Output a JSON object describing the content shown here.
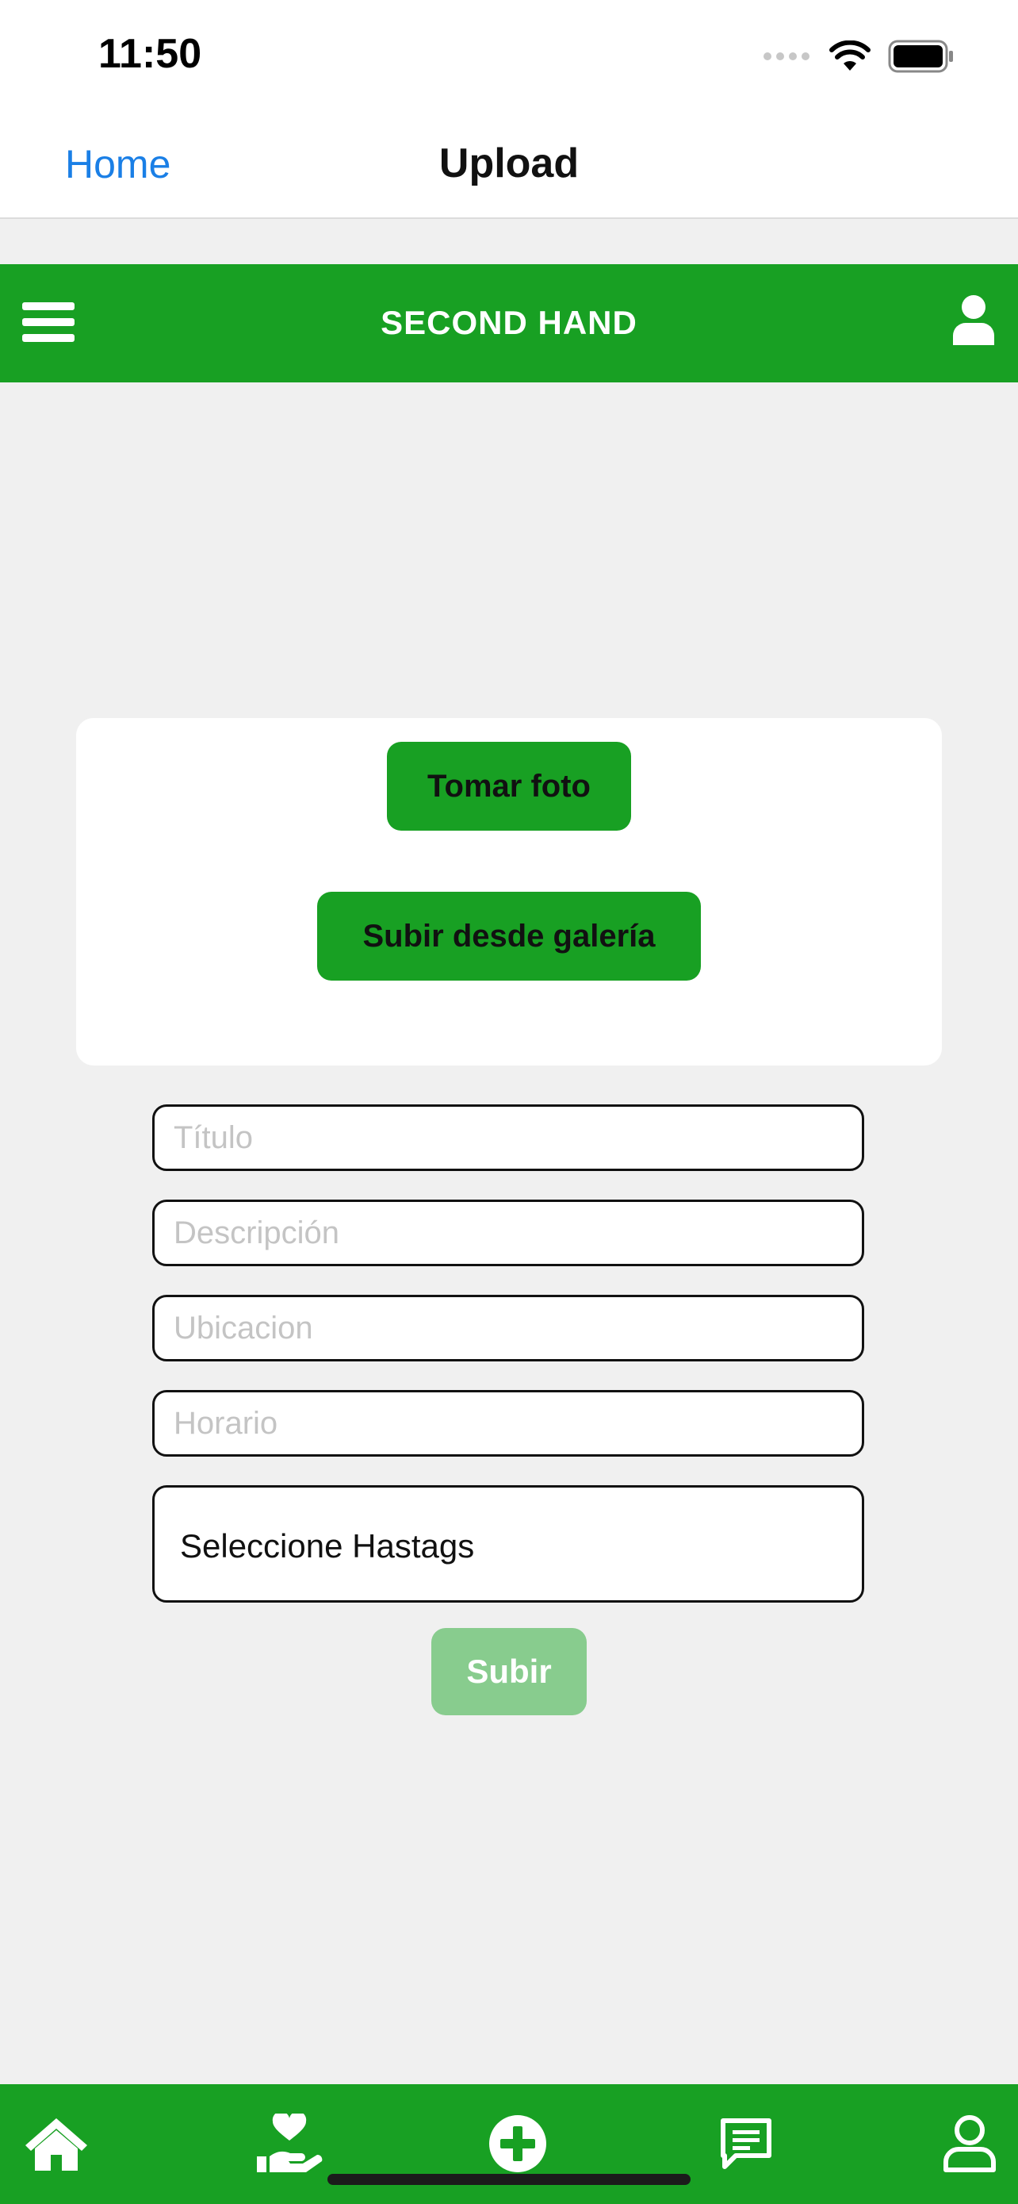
{
  "status_bar": {
    "time": "11:50"
  },
  "nav": {
    "back_label": "Home",
    "title": "Upload"
  },
  "header": {
    "brand": "SECOND HAND"
  },
  "photo_card": {
    "take_photo_label": "Tomar foto",
    "gallery_label": "Subir desde galería"
  },
  "form": {
    "title_placeholder": "Título",
    "description_placeholder": "Descripción",
    "location_placeholder": "Ubicacion",
    "schedule_placeholder": "Horario",
    "hashtags_label": "Seleccione Hastags",
    "submit_label": "Subir"
  },
  "colors": {
    "brand_green": "#18a023",
    "disabled_green": "#88cc8e",
    "link_blue": "#1a7fe6"
  },
  "tab_bar": {
    "icons": [
      "home-icon",
      "donate-heart-hand-icon",
      "add-circle-icon",
      "chat-icon",
      "profile-icon"
    ]
  }
}
